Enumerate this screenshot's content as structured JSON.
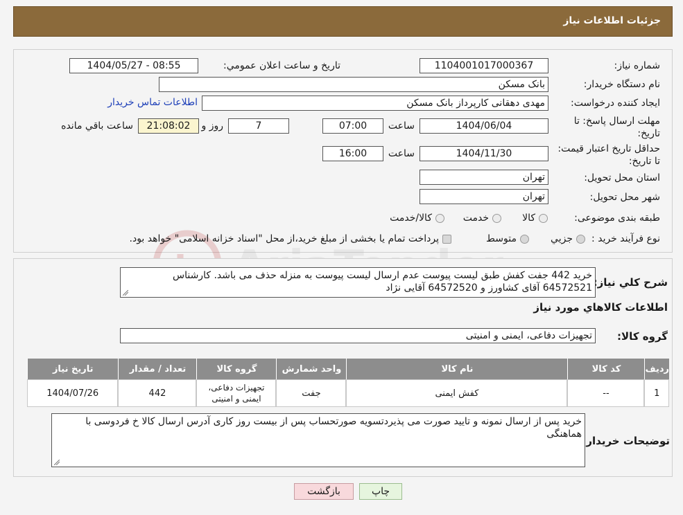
{
  "header": {
    "title": "جزئیات اطلاعات نیاز"
  },
  "form": {
    "need_number_label": "شماره نیاز:",
    "need_number": "1104001017000367",
    "announce_label": "تاریخ و ساعت اعلان عمومي:",
    "announce_value": "1404/05/27 - 08:55",
    "buyer_org_label": "نام دستگاه خریدار:",
    "buyer_org": "بانک مسکن",
    "creator_label": "ایجاد کننده درخواست:",
    "creator": "مهدی دهقانی کارپرداز بانک مسکن",
    "contact_link": "اطلاعات تماس خریدار",
    "reply_deadline_label": "مهلت ارسال پاسخ: تا تاریخ:",
    "reply_date": "1404/06/04",
    "time_label": "ساعت",
    "reply_time": "07:00",
    "days": "7",
    "days_label": "روز و",
    "remaining_time": "21:08:02",
    "remaining_label": "ساعت باقي مانده",
    "price_valid_label": "حداقل تاریخ اعتبار قیمت: تا تاریخ:",
    "price_valid_date": "1404/11/30",
    "price_valid_time": "16:00",
    "province_label": "استان محل تحویل:",
    "province": "تهران",
    "city_label": "شهر محل تحویل:",
    "city": "تهران",
    "category_label": "طبقه بندی موضوعی:",
    "category_options": [
      "کالا",
      "خدمت",
      "کالا/خدمت"
    ],
    "purchase_type_label": "نوع فرآیند خرید :",
    "purchase_options": [
      "جزيي",
      "متوسط"
    ],
    "purchase_note": "پرداخت تمام یا بخشی از مبلغ خرید،از محل \"اسناد خزانه اسلامی\" خواهد بود."
  },
  "description": {
    "label": "شرح کلي نیاز:",
    "text": "خرید 442 جفت کفش طبق لیست پیوست عدم ارسال لیست پیوست به منزله حذف می باشد. کارشناس 64572521 آقای کشاورز و 64572520 آقایی نژاد"
  },
  "goods": {
    "section_title": "اطلاعات کالاهاي مورد نیاز",
    "group_label": "گروه کالا:",
    "group_value": "تجهیزات دفاعی، ایمنی و امنیتی",
    "columns": [
      "ردیف",
      "کد کالا",
      "نام کالا",
      "واحد شمارش",
      "گروه کالا",
      "تعداد / مقدار",
      "تاریخ نیاز"
    ],
    "rows": [
      {
        "row": "1",
        "code": "--",
        "name": "کفش ایمنی",
        "unit": "جفت",
        "group": "تجهیزات دفاعی، ایمنی و امنیتی",
        "qty": "442",
        "date": "1404/07/26"
      }
    ]
  },
  "buyer_notes": {
    "label": "توضیحات خریدار:",
    "text": "خرید پس از ارسال نمونه و تایید صورت می پذیردتسویه صورتحساب پس از بیست روز کاری آدرس ارسال کالا خ فردوسی با هماهنگی"
  },
  "buttons": {
    "print": "چاپ",
    "back": "بازگشت"
  },
  "colors": {
    "header": "#8b6a3b",
    "table_header": "#8d8d8d",
    "back_button": "#f8d9dc",
    "print_button": "#e6f5de",
    "link": "#1d3fb8"
  }
}
